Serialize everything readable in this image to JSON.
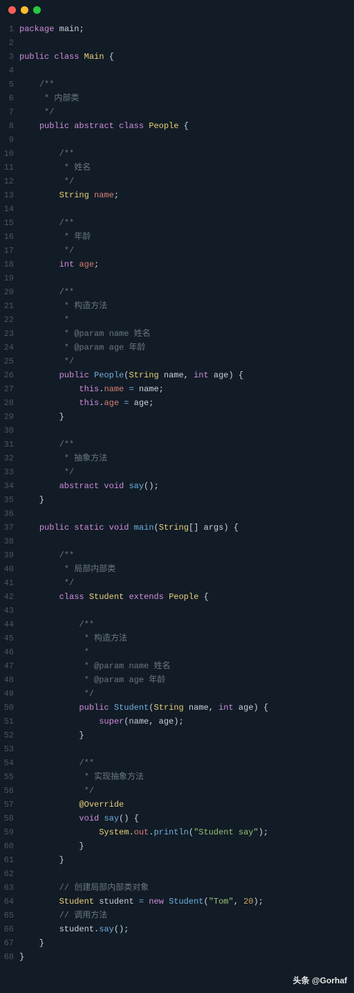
{
  "watermark": "头条 @Gorhaf",
  "lines": [
    {
      "n": 1,
      "t": [
        [
          "kw",
          "package"
        ],
        [
          "pun",
          " main"
        ],
        [
          "pun",
          ";"
        ]
      ]
    },
    {
      "n": 2,
      "t": []
    },
    {
      "n": 3,
      "t": [
        [
          "kw",
          "public"
        ],
        [
          "pun",
          " "
        ],
        [
          "kw",
          "class"
        ],
        [
          "pun",
          " "
        ],
        [
          "cls",
          "Main"
        ],
        [
          "pun",
          " {"
        ]
      ]
    },
    {
      "n": 4,
      "t": []
    },
    {
      "n": 5,
      "t": [
        [
          "pun",
          "    "
        ],
        [
          "cmt",
          "/**"
        ]
      ]
    },
    {
      "n": 6,
      "t": [
        [
          "pun",
          "    "
        ],
        [
          "cmt",
          " * 内部类"
        ]
      ]
    },
    {
      "n": 7,
      "t": [
        [
          "pun",
          "    "
        ],
        [
          "cmt",
          " */"
        ]
      ]
    },
    {
      "n": 8,
      "t": [
        [
          "pun",
          "    "
        ],
        [
          "kw",
          "public"
        ],
        [
          "pun",
          " "
        ],
        [
          "kw",
          "abstract"
        ],
        [
          "pun",
          " "
        ],
        [
          "kw",
          "class"
        ],
        [
          "pun",
          " "
        ],
        [
          "cls",
          "People"
        ],
        [
          "pun",
          " {"
        ]
      ]
    },
    {
      "n": 9,
      "t": []
    },
    {
      "n": 10,
      "t": [
        [
          "pun",
          "        "
        ],
        [
          "cmt",
          "/**"
        ]
      ]
    },
    {
      "n": 11,
      "t": [
        [
          "pun",
          "        "
        ],
        [
          "cmt",
          " * 姓名"
        ]
      ]
    },
    {
      "n": 12,
      "t": [
        [
          "pun",
          "        "
        ],
        [
          "cmt",
          " */"
        ]
      ]
    },
    {
      "n": 13,
      "t": [
        [
          "pun",
          "        "
        ],
        [
          "cls",
          "String"
        ],
        [
          "pun",
          " "
        ],
        [
          "var",
          "name"
        ],
        [
          "pun",
          ";"
        ]
      ]
    },
    {
      "n": 14,
      "t": []
    },
    {
      "n": 15,
      "t": [
        [
          "pun",
          "        "
        ],
        [
          "cmt",
          "/**"
        ]
      ]
    },
    {
      "n": 16,
      "t": [
        [
          "pun",
          "        "
        ],
        [
          "cmt",
          " * 年龄"
        ]
      ]
    },
    {
      "n": 17,
      "t": [
        [
          "pun",
          "        "
        ],
        [
          "cmt",
          " */"
        ]
      ]
    },
    {
      "n": 18,
      "t": [
        [
          "pun",
          "        "
        ],
        [
          "typ",
          "int"
        ],
        [
          "pun",
          " "
        ],
        [
          "var",
          "age"
        ],
        [
          "pun",
          ";"
        ]
      ]
    },
    {
      "n": 19,
      "t": []
    },
    {
      "n": 20,
      "t": [
        [
          "pun",
          "        "
        ],
        [
          "cmt",
          "/**"
        ]
      ]
    },
    {
      "n": 21,
      "t": [
        [
          "pun",
          "        "
        ],
        [
          "cmt",
          " * 构造方法"
        ]
      ]
    },
    {
      "n": 22,
      "t": [
        [
          "pun",
          "        "
        ],
        [
          "cmt",
          " *"
        ]
      ]
    },
    {
      "n": 23,
      "t": [
        [
          "pun",
          "        "
        ],
        [
          "cmt",
          " * @param name 姓名"
        ]
      ]
    },
    {
      "n": 24,
      "t": [
        [
          "pun",
          "        "
        ],
        [
          "cmt",
          " * @param age 年龄"
        ]
      ]
    },
    {
      "n": 25,
      "t": [
        [
          "pun",
          "        "
        ],
        [
          "cmt",
          " */"
        ]
      ]
    },
    {
      "n": 26,
      "t": [
        [
          "pun",
          "        "
        ],
        [
          "kw",
          "public"
        ],
        [
          "pun",
          " "
        ],
        [
          "fn",
          "People"
        ],
        [
          "pun",
          "("
        ],
        [
          "cls",
          "String"
        ],
        [
          "pun",
          " name, "
        ],
        [
          "typ",
          "int"
        ],
        [
          "pun",
          " age) {"
        ]
      ]
    },
    {
      "n": 27,
      "t": [
        [
          "pun",
          "            "
        ],
        [
          "kw",
          "this"
        ],
        [
          "pun",
          "."
        ],
        [
          "var",
          "name"
        ],
        [
          "pun",
          " "
        ],
        [
          "op",
          "="
        ],
        [
          "pun",
          " name;"
        ]
      ]
    },
    {
      "n": 28,
      "t": [
        [
          "pun",
          "            "
        ],
        [
          "kw",
          "this"
        ],
        [
          "pun",
          "."
        ],
        [
          "var",
          "age"
        ],
        [
          "pun",
          " "
        ],
        [
          "op",
          "="
        ],
        [
          "pun",
          " age;"
        ]
      ]
    },
    {
      "n": 29,
      "t": [
        [
          "pun",
          "        }"
        ]
      ]
    },
    {
      "n": 30,
      "t": []
    },
    {
      "n": 31,
      "t": [
        [
          "pun",
          "        "
        ],
        [
          "cmt",
          "/**"
        ]
      ]
    },
    {
      "n": 32,
      "t": [
        [
          "pun",
          "        "
        ],
        [
          "cmt",
          " * 抽象方法"
        ]
      ]
    },
    {
      "n": 33,
      "t": [
        [
          "pun",
          "        "
        ],
        [
          "cmt",
          " */"
        ]
      ]
    },
    {
      "n": 34,
      "t": [
        [
          "pun",
          "        "
        ],
        [
          "kw",
          "abstract"
        ],
        [
          "pun",
          " "
        ],
        [
          "typ",
          "void"
        ],
        [
          "pun",
          " "
        ],
        [
          "fn",
          "say"
        ],
        [
          "pun",
          "();"
        ]
      ]
    },
    {
      "n": 35,
      "t": [
        [
          "pun",
          "    }"
        ]
      ]
    },
    {
      "n": 36,
      "t": []
    },
    {
      "n": 37,
      "t": [
        [
          "pun",
          "    "
        ],
        [
          "kw",
          "public"
        ],
        [
          "pun",
          " "
        ],
        [
          "kw",
          "static"
        ],
        [
          "pun",
          " "
        ],
        [
          "typ",
          "void"
        ],
        [
          "pun",
          " "
        ],
        [
          "fn",
          "main"
        ],
        [
          "pun",
          "("
        ],
        [
          "cls",
          "String"
        ],
        [
          "pun",
          "[] args) {"
        ]
      ]
    },
    {
      "n": 38,
      "t": []
    },
    {
      "n": 39,
      "t": [
        [
          "pun",
          "        "
        ],
        [
          "cmt",
          "/**"
        ]
      ]
    },
    {
      "n": 40,
      "t": [
        [
          "pun",
          "        "
        ],
        [
          "cmt",
          " * 局部内部类"
        ]
      ]
    },
    {
      "n": 41,
      "t": [
        [
          "pun",
          "        "
        ],
        [
          "cmt",
          " */"
        ]
      ]
    },
    {
      "n": 42,
      "t": [
        [
          "pun",
          "        "
        ],
        [
          "kw",
          "class"
        ],
        [
          "pun",
          " "
        ],
        [
          "cls",
          "Student"
        ],
        [
          "pun",
          " "
        ],
        [
          "kw",
          "extends"
        ],
        [
          "pun",
          " "
        ],
        [
          "cls",
          "People"
        ],
        [
          "pun",
          " {"
        ]
      ]
    },
    {
      "n": 43,
      "t": []
    },
    {
      "n": 44,
      "t": [
        [
          "pun",
          "            "
        ],
        [
          "cmt",
          "/**"
        ]
      ]
    },
    {
      "n": 45,
      "t": [
        [
          "pun",
          "            "
        ],
        [
          "cmt",
          " * 构造方法"
        ]
      ]
    },
    {
      "n": 46,
      "t": [
        [
          "pun",
          "            "
        ],
        [
          "cmt",
          " *"
        ]
      ]
    },
    {
      "n": 47,
      "t": [
        [
          "pun",
          "            "
        ],
        [
          "cmt",
          " * @param name 姓名"
        ]
      ]
    },
    {
      "n": 48,
      "t": [
        [
          "pun",
          "            "
        ],
        [
          "cmt",
          " * @param age 年龄"
        ]
      ]
    },
    {
      "n": 49,
      "t": [
        [
          "pun",
          "            "
        ],
        [
          "cmt",
          " */"
        ]
      ]
    },
    {
      "n": 50,
      "t": [
        [
          "pun",
          "            "
        ],
        [
          "kw",
          "public"
        ],
        [
          "pun",
          " "
        ],
        [
          "fn",
          "Student"
        ],
        [
          "pun",
          "("
        ],
        [
          "cls",
          "String"
        ],
        [
          "pun",
          " name, "
        ],
        [
          "typ",
          "int"
        ],
        [
          "pun",
          " age) {"
        ]
      ]
    },
    {
      "n": 51,
      "t": [
        [
          "pun",
          "                "
        ],
        [
          "kw",
          "super"
        ],
        [
          "pun",
          "(name, age);"
        ]
      ]
    },
    {
      "n": 52,
      "t": [
        [
          "pun",
          "            }"
        ]
      ]
    },
    {
      "n": 53,
      "t": []
    },
    {
      "n": 54,
      "t": [
        [
          "pun",
          "            "
        ],
        [
          "cmt",
          "/**"
        ]
      ]
    },
    {
      "n": 55,
      "t": [
        [
          "pun",
          "            "
        ],
        [
          "cmt",
          " * 实现抽象方法"
        ]
      ]
    },
    {
      "n": 56,
      "t": [
        [
          "pun",
          "            "
        ],
        [
          "cmt",
          " */"
        ]
      ]
    },
    {
      "n": 57,
      "t": [
        [
          "pun",
          "            "
        ],
        [
          "ann",
          "@Override"
        ]
      ]
    },
    {
      "n": 58,
      "t": [
        [
          "pun",
          "            "
        ],
        [
          "typ",
          "void"
        ],
        [
          "pun",
          " "
        ],
        [
          "fn",
          "say"
        ],
        [
          "pun",
          "() {"
        ]
      ]
    },
    {
      "n": 59,
      "t": [
        [
          "pun",
          "                "
        ],
        [
          "cls",
          "System"
        ],
        [
          "pun",
          "."
        ],
        [
          "var",
          "out"
        ],
        [
          "pun",
          "."
        ],
        [
          "fn",
          "println"
        ],
        [
          "pun",
          "("
        ],
        [
          "str",
          "\"Student say\""
        ],
        [
          "pun",
          ");"
        ]
      ]
    },
    {
      "n": 60,
      "t": [
        [
          "pun",
          "            }"
        ]
      ]
    },
    {
      "n": 61,
      "t": [
        [
          "pun",
          "        }"
        ]
      ]
    },
    {
      "n": 62,
      "t": []
    },
    {
      "n": 63,
      "t": [
        [
          "pun",
          "        "
        ],
        [
          "cmt",
          "// 创建局部内部类对象"
        ]
      ]
    },
    {
      "n": 64,
      "t": [
        [
          "pun",
          "        "
        ],
        [
          "cls",
          "Student"
        ],
        [
          "pun",
          " student "
        ],
        [
          "op",
          "="
        ],
        [
          "pun",
          " "
        ],
        [
          "kw",
          "new"
        ],
        [
          "pun",
          " "
        ],
        [
          "fn",
          "Student"
        ],
        [
          "pun",
          "("
        ],
        [
          "str",
          "\"Tom\""
        ],
        [
          "pun",
          ", "
        ],
        [
          "num",
          "20"
        ],
        [
          "pun",
          ");"
        ]
      ]
    },
    {
      "n": 65,
      "t": [
        [
          "pun",
          "        "
        ],
        [
          "cmt",
          "// 调用方法"
        ]
      ]
    },
    {
      "n": 66,
      "t": [
        [
          "pun",
          "        student."
        ],
        [
          "fn",
          "say"
        ],
        [
          "pun",
          "();"
        ]
      ]
    },
    {
      "n": 67,
      "t": [
        [
          "pun",
          "    }"
        ]
      ]
    },
    {
      "n": 68,
      "t": [
        [
          "pun",
          "}"
        ]
      ]
    }
  ]
}
